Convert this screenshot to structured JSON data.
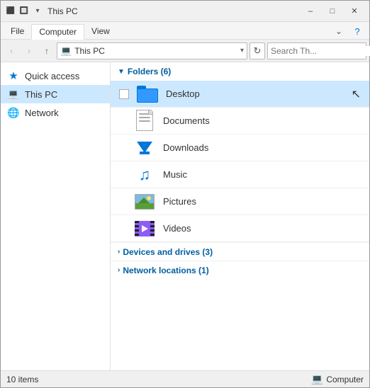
{
  "titleBar": {
    "title": "This PC",
    "minimizeLabel": "–",
    "maximizeLabel": "□",
    "closeLabel": "✕"
  },
  "ribbon": {
    "tabs": [
      "File",
      "Computer",
      "View"
    ],
    "activeTab": "Computer",
    "charmLabel": "⌄",
    "helpLabel": "?"
  },
  "addressBar": {
    "backTooltip": "Back",
    "forwardTooltip": "Forward",
    "upTooltip": "Up",
    "addressText": "This PC",
    "refreshTooltip": "Refresh",
    "searchPlaceholder": "Search Th...",
    "searchLabel": "Search"
  },
  "sidebar": {
    "items": [
      {
        "id": "quick-access",
        "label": "Quick access",
        "iconType": "star"
      },
      {
        "id": "this-pc",
        "label": "This PC",
        "iconType": "pc",
        "active": true
      },
      {
        "id": "network",
        "label": "Network",
        "iconType": "network"
      }
    ]
  },
  "content": {
    "foldersSection": {
      "label": "Folders (6)",
      "expanded": true,
      "folders": [
        {
          "id": "desktop",
          "label": "Desktop",
          "iconType": "desktop",
          "selected": true,
          "showCheckbox": true
        },
        {
          "id": "documents",
          "label": "Documents",
          "iconType": "documents",
          "selected": false
        },
        {
          "id": "downloads",
          "label": "Downloads",
          "iconType": "downloads",
          "selected": false
        },
        {
          "id": "music",
          "label": "Music",
          "iconType": "music",
          "selected": false
        },
        {
          "id": "pictures",
          "label": "Pictures",
          "iconType": "pictures",
          "selected": false
        },
        {
          "id": "videos",
          "label": "Videos",
          "iconType": "videos",
          "selected": false
        }
      ]
    },
    "devicesSection": {
      "label": "Devices and drives (3)",
      "expanded": false
    },
    "networkSection": {
      "label": "Network locations (1)",
      "expanded": false
    }
  },
  "statusBar": {
    "itemCount": "10 items",
    "computerLabel": "Computer"
  }
}
